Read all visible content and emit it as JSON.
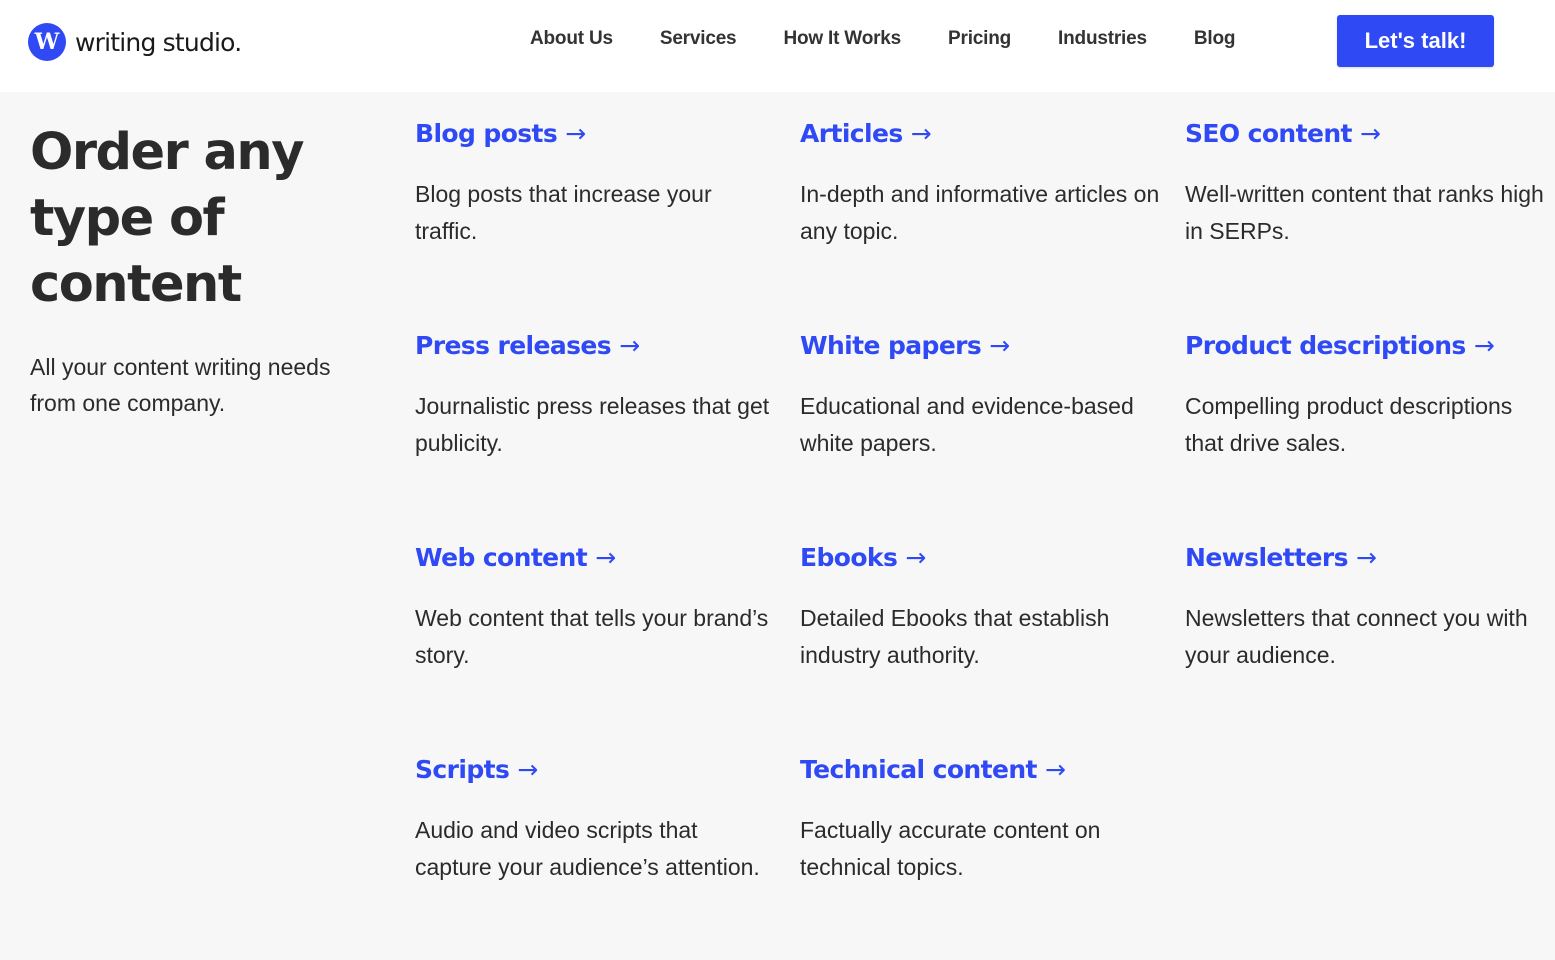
{
  "header": {
    "logo": {
      "mark": "W",
      "text": "writing studio."
    },
    "nav": [
      "About Us",
      "Services",
      "How It Works",
      "Pricing",
      "Industries",
      "Blog"
    ],
    "cta_label": "Let's talk!"
  },
  "hero": {
    "title": "Order any type of content",
    "subtitle": "All your content writing needs from one company."
  },
  "arrow_icon": "→",
  "services": [
    {
      "title": "Blog posts",
      "description": "Blog posts that increase your traffic."
    },
    {
      "title": "Articles",
      "description": "In-depth and informative articles on any topic."
    },
    {
      "title": "SEO content",
      "description": "Well-written content that ranks high in SERPs."
    },
    {
      "title": "Press releases",
      "description": "Journalistic press releases that get publicity."
    },
    {
      "title": "White papers",
      "description": "Educational and evidence-based white papers."
    },
    {
      "title": "Product descriptions",
      "description": "Compelling product descriptions that drive sales."
    },
    {
      "title": "Web content",
      "description": "Web content that tells your brand’s story."
    },
    {
      "title": "Ebooks",
      "description": "Detailed Ebooks that establish industry authority."
    },
    {
      "title": "Newsletters",
      "description": "Newsletters that connect you with your audience."
    },
    {
      "title": "Scripts",
      "description": "Audio and video scripts that capture your audience’s attention."
    },
    {
      "title": "Technical content",
      "description": "Factually accurate content on technical topics."
    }
  ],
  "colors": {
    "accent": "#2f49f5",
    "text": "#2b2b2b",
    "background": "#f7f7f7",
    "header_bg": "#ffffff"
  }
}
